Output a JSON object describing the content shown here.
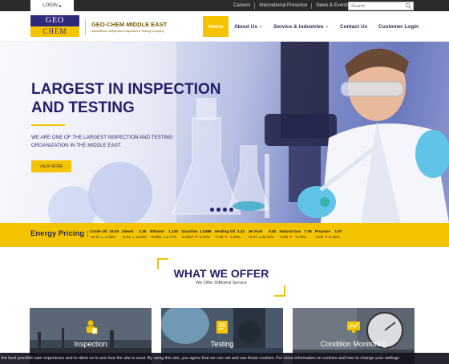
{
  "topbar": {
    "login_label": "LOGIN",
    "links": [
      "Careers",
      "International Presence",
      "News & Events"
    ],
    "search_placeholder": "Search"
  },
  "header": {
    "logo_top": "GEO",
    "logo_bottom": "CHEM",
    "company_name": "GEO-CHEM MIDDLE EAST",
    "company_tagline": "International Independent Inspection & Testing Company",
    "nav": [
      {
        "label": "Home",
        "active": true
      },
      {
        "label": "About Us",
        "dropdown": true
      },
      {
        "label": "Service & industries",
        "dropdown": true
      },
      {
        "label": "Contact Us"
      },
      {
        "label": "Customer Login"
      }
    ]
  },
  "hero": {
    "title": "LARGEST IN INSPECTION AND TESTING",
    "subtitle": "WE ARE ONE OF THE LARGEST INSPECTION AND TESTING ORGANIZATION IN THE MIDDLE EAST.",
    "button": "VIEW MORE",
    "slide_count": 4
  },
  "energy": {
    "title": "Energy Pricing :",
    "items": [
      {
        "name": "Crude Oil",
        "price": "33.92",
        "change": "+0.40",
        "dir": "up",
        "pct": "1.19%"
      },
      {
        "name": "Diesel",
        "price": "2.35",
        "change": "-0.01",
        "dir": "up",
        "pct": "-0.33%"
      },
      {
        "name": "Ethanol",
        "price": "1.120",
        "change": "+0.051",
        "dir": "up",
        "pct": "4.77%"
      },
      {
        "name": "Gasoline",
        "price": "1.0486",
        "change": "-0.0117",
        "dir": "down",
        "pct": "-1.10%"
      },
      {
        "name": "Heating Oil",
        "price": "2.42",
        "change": "-0.03",
        "dir": "down",
        "pct": "-1.18%"
      },
      {
        "name": "Jet Fuel",
        "price": "0.82",
        "change": "+0.27",
        "dir": "up",
        "pct": "48.11%"
      },
      {
        "name": "Natural Gas",
        "price": "7.06",
        "change": "-0.20",
        "dir": "down",
        "pct": "-2.75%"
      },
      {
        "name": "Propane",
        "price": "1.87",
        "change": "-0.04",
        "dir": "down",
        "pct": "-2.20%"
      }
    ]
  },
  "offer": {
    "title": "WHAT WE OFFER",
    "subtitle": "We Offer Different Service",
    "cards": [
      {
        "label": "Inspection",
        "icon": "inspector-icon"
      },
      {
        "label": "Testing",
        "icon": "document-icon"
      },
      {
        "label": "Condition Monitoring",
        "icon": "monitor-chart-icon"
      }
    ]
  },
  "cookie": {
    "text": "ou the best possible user experience and to allow us to see how the site is used. By using this site, you agree that we can set and use these cookies. For more information on cookies and how to change your settings"
  },
  "colors": {
    "brand_navy": "#241f6b",
    "brand_yellow": "#f5c400"
  }
}
